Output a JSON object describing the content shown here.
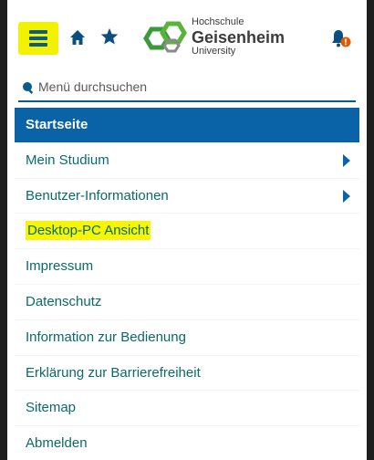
{
  "header": {
    "logo": {
      "line1": "Hochschule",
      "line2": "Geisenheim",
      "line3": "University"
    },
    "icons": {
      "menu": "hamburger-menu-icon",
      "home": "home-icon",
      "star": "star-icon",
      "bell": "notification-bell-icon"
    },
    "colors": {
      "highlight": "#f2f200",
      "accent": "#0a63a6",
      "alert": "#e05a00"
    }
  },
  "search": {
    "placeholder": "Menü durchsuchen"
  },
  "menu": {
    "items": [
      {
        "label": "Startseite",
        "active": true
      },
      {
        "label": "Mein Studium",
        "has_submenu": true
      },
      {
        "label": "Benutzer-Informationen",
        "has_submenu": true
      },
      {
        "label": "Desktop-PC Ansicht",
        "highlighted": true
      },
      {
        "label": "Impressum"
      },
      {
        "label": "Datenschutz"
      },
      {
        "label": "Information zur Bedienung"
      },
      {
        "label": "Erklärung zur Barrierefreiheit"
      },
      {
        "label": "Sitemap"
      },
      {
        "label": "Abmelden"
      }
    ]
  }
}
